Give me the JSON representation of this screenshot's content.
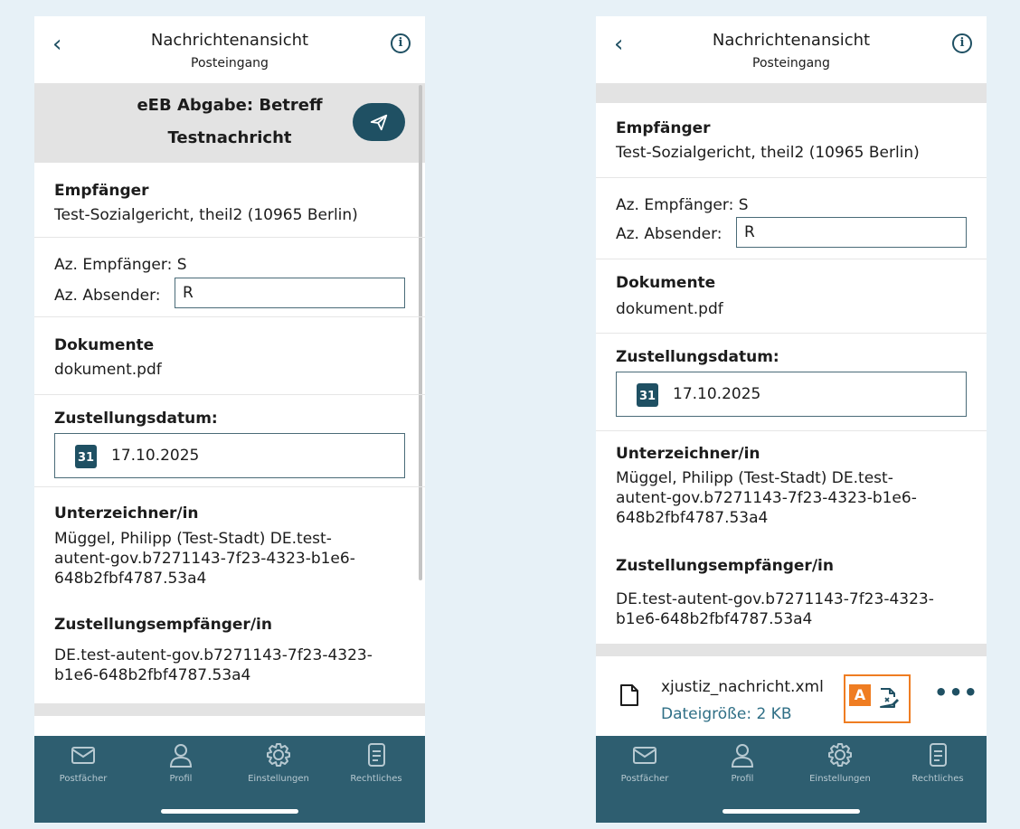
{
  "left": {
    "header": {
      "back": "‹",
      "title": "Nachrichtenansicht",
      "subtitle": "Posteingang",
      "info": "i"
    },
    "subject": {
      "line1": "eEB Abgabe: Betreff",
      "line2": "Testnachricht"
    },
    "empfaenger": {
      "label": "Empfänger",
      "value": "Test-Sozialgericht, theil2 (10965 Berlin)"
    },
    "az": {
      "empfaenger": "Az. Empfänger: S",
      "absender_label": "Az. Absender:",
      "absender_value": "R"
    },
    "dokumente": {
      "label": "Dokumente",
      "value": "dokument.pdf"
    },
    "zustellung": {
      "label": "Zustellungsdatum:",
      "cal": "31",
      "date": "17.10.2025"
    },
    "unterzeichner": {
      "label": "Unterzeichner/in",
      "line1": "Müggel, Philipp (Test-Stadt) DE.test-",
      "line2": "autent-gov.b7271143-7f23-4323-b1e6-",
      "line3": "648b2fbf4787.53a4"
    },
    "zustellungsempfaenger": {
      "label": "Zustellungsempfänger/in",
      "line1": "DE.test-autent-gov.b7271143-7f23-4323-",
      "line2": "b1e6-648b2fbf4787.53a4"
    }
  },
  "right": {
    "header": {
      "back": "‹",
      "title": "Nachrichtenansicht",
      "subtitle": "Posteingang",
      "info": "i"
    },
    "empfaenger": {
      "label": "Empfänger",
      "value": "Test-Sozialgericht, theil2 (10965 Berlin)"
    },
    "az": {
      "empfaenger": "Az. Empfänger: S",
      "absender_label": "Az. Absender:",
      "absender_value": "R"
    },
    "dokumente": {
      "label": "Dokumente",
      "value": "dokument.pdf"
    },
    "zustellung": {
      "label": "Zustellungsdatum:",
      "cal": "31",
      "date": "17.10.2025"
    },
    "unterzeichner": {
      "label": "Unterzeichner/in",
      "line1": "Müggel, Philipp (Test-Stadt) DE.test-",
      "line2": "autent-gov.b7271143-7f23-4323-b1e6-",
      "line3": "648b2fbf4787.53a4"
    },
    "zustellungsempfaenger": {
      "label": "Zustellungsempfänger/in",
      "line1": "DE.test-autent-gov.b7271143-7f23-4323-",
      "line2": "b1e6-648b2fbf4787.53a4"
    },
    "attachment": {
      "name": "xjustiz_nachricht.xml",
      "size": "Dateigröße: 2 KB",
      "badge": "A",
      "more": "•••"
    }
  },
  "tabbar": {
    "items": [
      {
        "label": "Postfächer",
        "icon": "mail-icon"
      },
      {
        "label": "Profil",
        "icon": "person-icon"
      },
      {
        "label": "Einstellungen",
        "icon": "gear-icon"
      },
      {
        "label": "Rechtliches",
        "icon": "document-icon"
      }
    ]
  },
  "colors": {
    "primary": "#1f5063",
    "tabbar": "#2e5e70",
    "highlight": "#ef7d22",
    "background": "#e7f1f7"
  }
}
